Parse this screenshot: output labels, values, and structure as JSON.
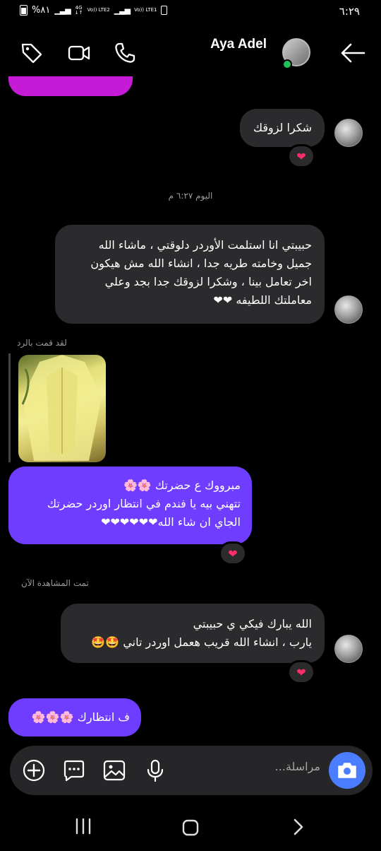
{
  "status_bar": {
    "time": "٦:٢٩",
    "battery": "%٨١",
    "network1": "4G",
    "volte1": "Vo)) LTE2",
    "volte2": "Vo)) LTE1"
  },
  "header": {
    "contact_name": "Aya Adel",
    "online": true
  },
  "messages": {
    "m1_text": "شكرا لزوقك",
    "m1_reaction": "❤",
    "timestamp": "اليوم ٦:٢٧ م",
    "m2_line1": "حبيبتي انا استلمت الأوردر دلوقتي ، ماشاء الله",
    "m2_line2": "جميل وخامته طريه جدا ، انشاء الله مش هيكون",
    "m2_line3": "اخر تعامل بينا ، وشكرا لزوقك جدا بجد وعلي",
    "m2_line4": "معاملتك اللطيفه ❤❤",
    "reply_label": "لقد قمت بالرد",
    "m3_line1": "مبرووك ع حضرتك 🌸🌸",
    "m3_line2": "تتهني بيه يا فندم في انتظار اوردر حضرتك",
    "m3_line3": "الجاي ان شاء الله❤❤❤❤❤❤",
    "m3_reaction": "❤",
    "seen_label": "تمت المشاهدة الآن",
    "m4_line1": "الله يبارك فيكي ي حبيبتي",
    "m4_line2": "يارب ، انشاء الله قريب هعمل اوردر تاني 🤩🤩",
    "m4_reaction": "❤",
    "m5_text": "ف انتظارك 🌸🌸🌸"
  },
  "composer": {
    "placeholder": "مراسلة..."
  },
  "colors": {
    "purple_bubble": "#6f3dff",
    "gray_bubble": "#2b2b2e",
    "magenta_bubble": "#c51bd6",
    "accent_camera": "#4a7dff",
    "online": "#21c15a"
  },
  "icons": [
    "back-arrow-icon",
    "phone-icon",
    "video-icon",
    "tag-icon",
    "camera-icon",
    "microphone-icon",
    "gallery-icon",
    "chat-bubble-icon",
    "plus-circle-icon",
    "recent-apps-icon",
    "home-icon",
    "back-nav-icon"
  ]
}
